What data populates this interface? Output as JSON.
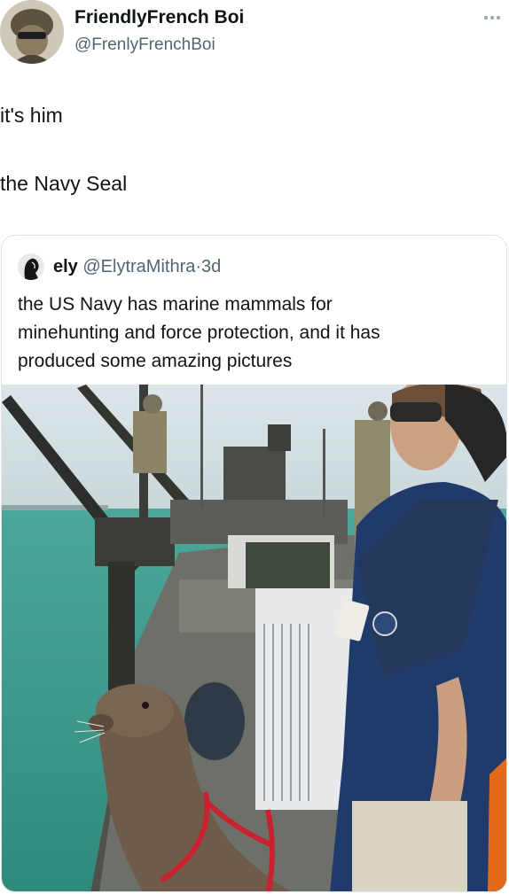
{
  "author": {
    "display_name": "FriendlyFrench Boi",
    "handle": "@FrenlyFrenchBoi",
    "avatar_icon": "soldier-avatar-icon"
  },
  "tweet": {
    "lines": [
      "it's him",
      "the Navy Seal"
    ]
  },
  "more_icon": "more-options-icon",
  "quote": {
    "name": "ely",
    "handle": "@ElytraMithra",
    "separator": "·",
    "time": "3d",
    "avatar_icon": "silhouette-avatar-icon",
    "text_lines": [
      "the US Navy has marine mammals for",
      "minehunting and force protection, and it has",
      "produced some amazing pictures"
    ],
    "photo_description_icon": "navy-boat-seal-photo"
  },
  "colors": {
    "text": "#0f1419",
    "secondary": "#536471",
    "border": "#dfe4e8",
    "sea": "#3e9a8c",
    "harness": "#c8212f",
    "shirt": "#1f3a6b"
  }
}
